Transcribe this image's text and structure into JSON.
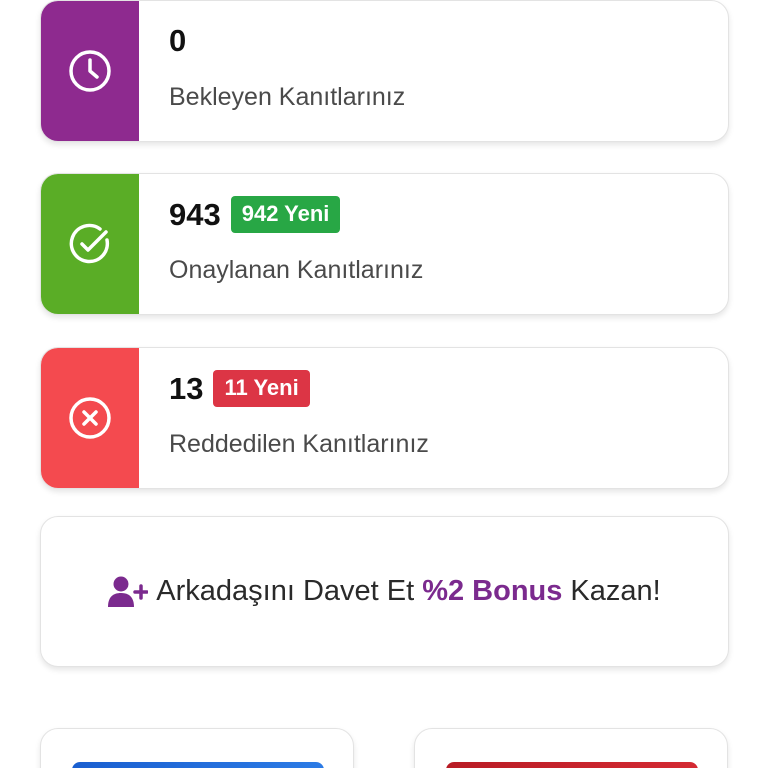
{
  "cards": {
    "pending": {
      "count": "0",
      "label": "Bekleyen Kanıtlarınız",
      "color": "#8e2a8f",
      "icon": "clock-icon"
    },
    "approved": {
      "count": "943",
      "badge": "942 Yeni",
      "badge_color": "#28a745",
      "label": "Onaylanan Kanıtlarınız",
      "color": "#5aad26",
      "icon": "check-circle-icon"
    },
    "rejected": {
      "count": "13",
      "badge": "11 Yeni",
      "badge_color": "#dc3545",
      "label": "Reddedilen Kanıtlarınız",
      "color": "#f44a4f",
      "icon": "x-circle-icon"
    }
  },
  "invite": {
    "icon": "user-plus-icon",
    "text_before": "Arkadaşını Davet Et",
    "bonus": "%2 Bonus",
    "text_after": "Kazan!",
    "accent_color": "#7b2a8e"
  },
  "bottom_cards": {
    "left_color": "#1a5fd0",
    "right_color": "#c8202a"
  }
}
